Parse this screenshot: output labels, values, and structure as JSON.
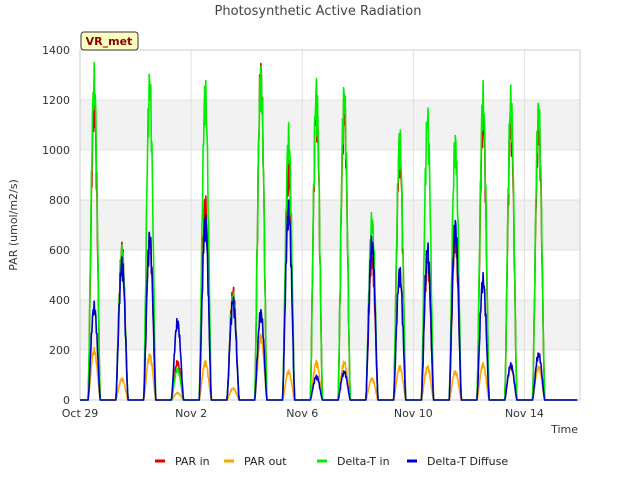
{
  "chart_data": {
    "type": "line",
    "title": "Photosynthetic Active Radiation",
    "xlabel": "Time",
    "ylabel": "PAR (umol/m2/s)",
    "site_label": "VR_met",
    "xlim": [
      "2022-10-29",
      "2022-11-16"
    ],
    "ylim": [
      0,
      1400
    ],
    "y_ticks": [
      0,
      200,
      400,
      600,
      800,
      1000,
      1200,
      1400
    ],
    "x_ticks": [
      {
        "date": "2022-10-29",
        "label": "Oct 29"
      },
      {
        "date": "2022-11-02",
        "label": "Nov 2"
      },
      {
        "date": "2022-11-06",
        "label": "Nov 6"
      },
      {
        "date": "2022-11-10",
        "label": "Nov 10"
      },
      {
        "date": "2022-11-14",
        "label": "Nov 14"
      }
    ],
    "background": "alternating grey bands every 200 units",
    "legend_position": "bottom",
    "days": [
      "2022-10-29",
      "2022-10-30",
      "2022-10-31",
      "2022-11-01",
      "2022-11-02",
      "2022-11-03",
      "2022-11-04",
      "2022-11-05",
      "2022-11-06",
      "2022-11-07",
      "2022-11-08",
      "2022-11-09",
      "2022-11-10",
      "2022-11-11",
      "2022-11-12",
      "2022-11-13",
      "2022-11-14",
      "2022-11-15"
    ],
    "series": [
      {
        "name": "PAR in",
        "color": "#dd0000",
        "daily_max": [
          1250,
          640,
          680,
          160,
          830,
          460,
          1380,
          960,
          1270,
          1240,
          600,
          1060,
          600,
          690,
          1200,
          1200,
          1160,
          0
        ]
      },
      {
        "name": "PAR out",
        "color": "#ffa500",
        "daily_max": [
          210,
          90,
          190,
          30,
          160,
          50,
          270,
          120,
          160,
          160,
          90,
          140,
          140,
          120,
          150,
          140,
          140,
          0
        ]
      },
      {
        "name": "Delta-T in",
        "color": "#00ee00",
        "daily_max": [
          1350,
          630,
          1340,
          130,
          1300,
          440,
          1370,
          1110,
          1300,
          1290,
          760,
          1100,
          1190,
          1090,
          1280,
          1270,
          1230,
          0
        ]
      },
      {
        "name": "Delta-T Diffuse",
        "color": "#0000cc",
        "daily_max": [
          395,
          580,
          690,
          330,
          750,
          420,
          370,
          800,
          100,
          120,
          665,
          540,
          640,
          740,
          510,
          150,
          195,
          0
        ]
      }
    ]
  },
  "legend": {
    "items": [
      {
        "label": "PAR in",
        "color": "#dd0000"
      },
      {
        "label": "PAR out",
        "color": "#ffa500"
      },
      {
        "label": "Delta-T in",
        "color": "#00ee00"
      },
      {
        "label": "Delta-T Diffuse",
        "color": "#0000cc"
      }
    ]
  }
}
